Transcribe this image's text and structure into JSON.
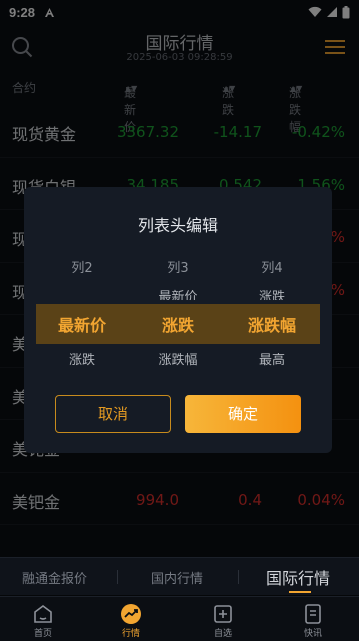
{
  "status": {
    "time": "9:28"
  },
  "header": {
    "title": "国际行情",
    "timestamp": "2025-06-03 09:28:59"
  },
  "columns": {
    "name": "合约",
    "price": "最新价",
    "change": "涨跌",
    "change_pct": "涨跌幅"
  },
  "rows": [
    {
      "name": "现货黄金",
      "price": "3367.32",
      "change": "-14.17",
      "pct": "-0.42%",
      "dir": "down"
    },
    {
      "name": "现货白银",
      "price": "34.185",
      "change": "0.542",
      "pct": "1.56%",
      "dir": "down"
    },
    {
      "name": "现",
      "price": "",
      "change": "",
      "pct": "%",
      "dir": "up"
    },
    {
      "name": "现",
      "price": "",
      "change": "",
      "pct": "%",
      "dir": "up"
    },
    {
      "name": "美",
      "price": "",
      "change": "",
      "pct": "",
      "dir": "up"
    },
    {
      "name": "美",
      "price": "",
      "change": "",
      "pct": "",
      "dir": "up"
    },
    {
      "name": "美铑金",
      "price": "",
      "change": "",
      "pct": "",
      "dir": "up"
    },
    {
      "name": "美钯金",
      "price": "994.0",
      "change": "0.4",
      "pct": "0.04%",
      "dir": "up"
    }
  ],
  "modal": {
    "title": "列表头编辑",
    "col_labels": [
      "列2",
      "列3",
      "列4"
    ],
    "above": [
      "",
      "最新价",
      "涨跌"
    ],
    "selected": [
      "最新价",
      "涨跌",
      "涨跌幅"
    ],
    "below": [
      "涨跌",
      "涨跌幅",
      "最高"
    ],
    "cancel": "取消",
    "confirm": "确定"
  },
  "tabs": [
    "融通金报价",
    "国内行情",
    "国际行情"
  ],
  "nav": [
    {
      "label": "首页",
      "icon": "home-icon"
    },
    {
      "label": "行情",
      "icon": "trend-icon"
    },
    {
      "label": "自选",
      "icon": "add-favorite-icon"
    },
    {
      "label": "快讯",
      "icon": "news-icon"
    }
  ],
  "colors": {
    "accent": "#f2a531",
    "up": "#e0302c",
    "down": "#1fa637",
    "background": "#0b0e13"
  }
}
